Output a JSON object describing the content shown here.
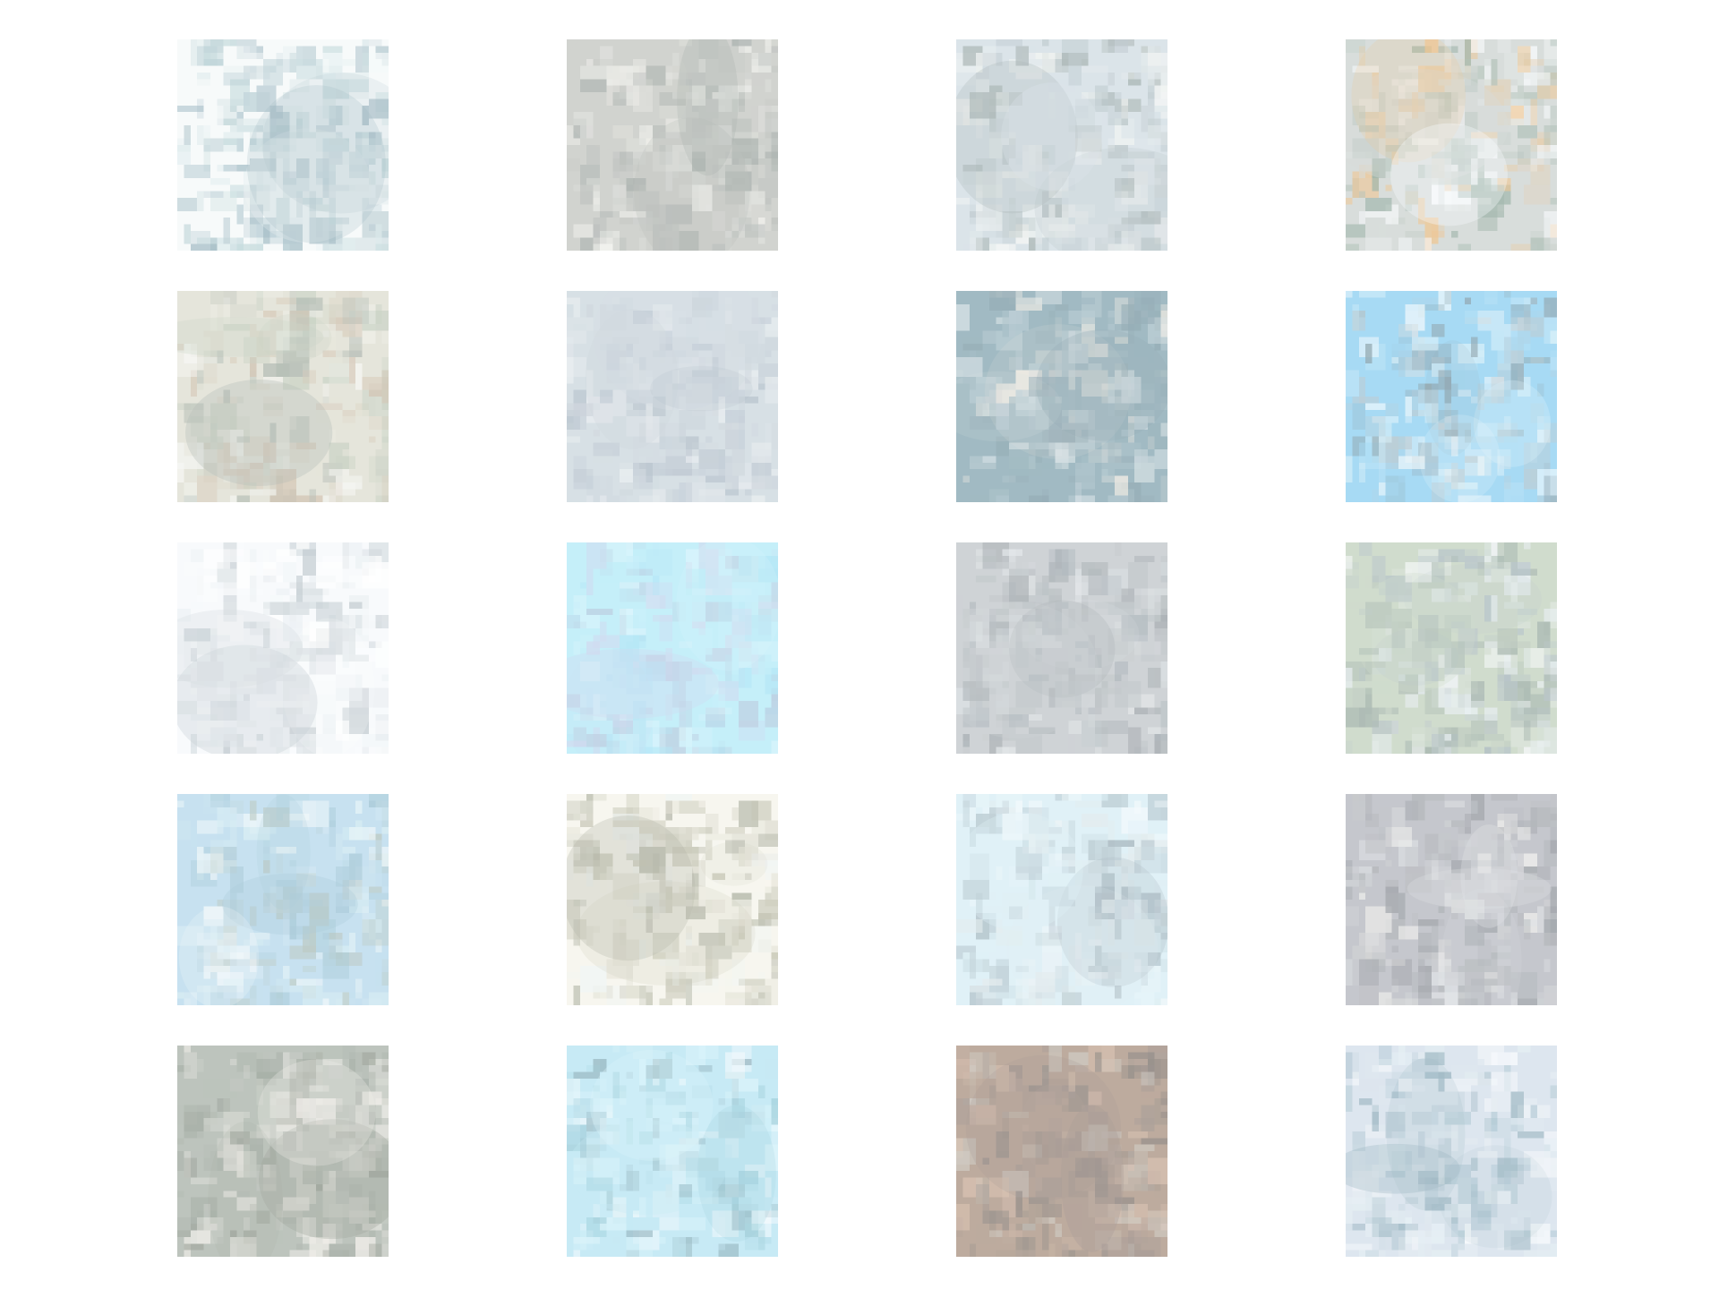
{
  "tiles": [
    {
      "name": "sample-r1-c1",
      "palette": [
        "#f3f8f8",
        "#8fb0bb",
        "#6f95a4",
        "#c9dfe2",
        "#a7c7cb"
      ]
    },
    {
      "name": "sample-r1-c2",
      "palette": [
        "#b9bcb6",
        "#f0f0ea",
        "#9aa09c",
        "#d9dbd6",
        "#7f8a86"
      ]
    },
    {
      "name": "sample-r1-c3",
      "palette": [
        "#c8d6de",
        "#f2f4f2",
        "#9fb1b7",
        "#e6ece9",
        "#7d8f8d"
      ]
    },
    {
      "name": "sample-r1-c4",
      "palette": [
        "#c3cbc8",
        "#e8a95a",
        "#8ea598",
        "#f5f8fb",
        "#6f8f7f"
      ]
    },
    {
      "name": "sample-r2-c1",
      "palette": [
        "#d8d8c8",
        "#bfa98f",
        "#f1f2ee",
        "#aebca8",
        "#8e9b90"
      ]
    },
    {
      "name": "sample-r2-c2",
      "palette": [
        "#c2cfd7",
        "#a9b8c6",
        "#dfe6ea",
        "#b7c2cc",
        "#8ea0b0"
      ]
    },
    {
      "name": "sample-r2-c3",
      "palette": [
        "#6f96a3",
        "#e9e2d6",
        "#98b4bf",
        "#c6d5da",
        "#5f8290"
      ]
    },
    {
      "name": "sample-r2-c4",
      "palette": [
        "#79c7ef",
        "#eef7fb",
        "#9bb3bd",
        "#5a7c8a",
        "#c6e8f6"
      ]
    },
    {
      "name": "sample-r3-c1",
      "palette": [
        "#f4f8fb",
        "#dfe7ec",
        "#c3cdd3",
        "#ffffff",
        "#a6b3bb"
      ]
    },
    {
      "name": "sample-r3-c2",
      "palette": [
        "#a6e6f6",
        "#8fdbf2",
        "#b9c8e8",
        "#c9f0fb",
        "#9ab4d0"
      ]
    },
    {
      "name": "sample-r3-c3",
      "palette": [
        "#b6bcc0",
        "#8b979f",
        "#d6dde0",
        "#a3acb0",
        "#7d878d"
      ]
    },
    {
      "name": "sample-r3-c4",
      "palette": [
        "#b7c9b3",
        "#dfe9ee",
        "#95a8b0",
        "#f3f7f8",
        "#7f958b"
      ]
    },
    {
      "name": "sample-r4-c1",
      "palette": [
        "#a9d2e8",
        "#7fb0c5",
        "#e9f4f8",
        "#9bb0a7",
        "#c7e6ef"
      ]
    },
    {
      "name": "sample-r4-c2",
      "palette": [
        "#f3f2e6",
        "#d8d6c5",
        "#a8a88f",
        "#e9f1f0",
        "#8b8f7a"
      ]
    },
    {
      "name": "sample-r4-c3",
      "palette": [
        "#cfeaf3",
        "#eef7fb",
        "#9cb3be",
        "#d6e2e6",
        "#7e96a2"
      ]
    },
    {
      "name": "sample-r4-c4",
      "palette": [
        "#a7aab2",
        "#e6e6e3",
        "#8c9197",
        "#cfd3d8",
        "#70767f"
      ]
    },
    {
      "name": "sample-r5-c1",
      "palette": [
        "#9aa59a",
        "#e9e6df",
        "#7f8c80",
        "#c6c9c0",
        "#6d7769"
      ]
    },
    {
      "name": "sample-r5-c2",
      "palette": [
        "#a9dff0",
        "#eaf6fb",
        "#6fb6c8",
        "#5d8c9a",
        "#c9eef8"
      ]
    },
    {
      "name": "sample-r5-c3",
      "palette": [
        "#9a7f6b",
        "#c7a38b",
        "#7d6b62",
        "#b7b0a4",
        "#5f564f"
      ]
    },
    {
      "name": "sample-r5-c4",
      "palette": [
        "#cbd9e6",
        "#f3f7fb",
        "#8fb1c2",
        "#d9e7ef",
        "#6f95a6"
      ]
    }
  ]
}
